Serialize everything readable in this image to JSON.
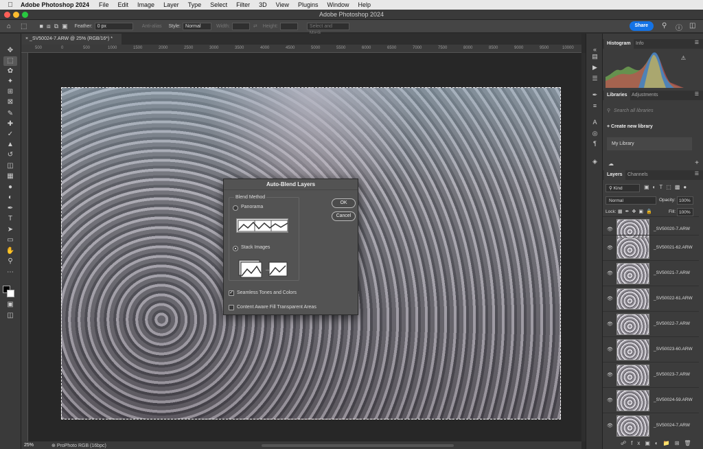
{
  "menubar": {
    "app_name": "Adobe Photoshop 2024",
    "items": [
      "File",
      "Edit",
      "Image",
      "Layer",
      "Type",
      "Select",
      "Filter",
      "3D",
      "View",
      "Plugins",
      "Window",
      "Help"
    ]
  },
  "window": {
    "title": "Adobe Photoshop 2024"
  },
  "options": {
    "feather_label": "Feather:",
    "feather_value": "0 px",
    "antialias_label": "Anti-alias",
    "style_label": "Style:",
    "style_value": "Normal",
    "width_label": "Width:",
    "height_label": "Height:",
    "select_mask_label": "Select and Mask...",
    "share_label": "Share"
  },
  "document": {
    "tab_label": "_SV50024-7.ARW @ 25% (RGB/16*) *",
    "zoom": "25%",
    "color_profile": "ProPhoto RGB (16bpc)"
  },
  "ruler_labels": [
    "500",
    "0",
    "500",
    "1000",
    "1500",
    "2000",
    "2500",
    "3000",
    "3500",
    "4000",
    "4500",
    "5000",
    "5500",
    "6000",
    "6500",
    "7000",
    "7500",
    "8000",
    "8500",
    "9000",
    "9500",
    "10000"
  ],
  "dialog": {
    "title": "Auto-Blend Layers",
    "group_label": "Blend Method",
    "option_panorama": "Panorama",
    "option_stack": "Stack Images",
    "seamless_label": "Seamless Tones and Colors",
    "content_aware_label": "Content Aware Fill Transparent Areas",
    "ok_label": "OK",
    "cancel_label": "Cancel",
    "selected_method": "Stack Images",
    "seamless_checked": true,
    "content_aware_checked": false
  },
  "panels": {
    "histogram_tab": "Histogram",
    "info_tab": "Info",
    "libraries_tab": "Libraries",
    "adjustments_tab": "Adjustments",
    "search_placeholder": "Search all libraries",
    "create_library": "Create new library",
    "my_library": "My Library",
    "layers_tab": "Layers",
    "channels_tab": "Channels",
    "kind_label": "Kind",
    "blend_mode": "Normal",
    "opacity_label": "Opacity:",
    "opacity_value": "100%",
    "lock_label": "Lock:",
    "fill_label": "Fill:",
    "fill_value": "100%"
  },
  "layers": [
    "_SV50020-7.ARW",
    "_SV50021-62.ARW",
    "_SV50021-7.ARW",
    "_SV50022-61.ARW",
    "_SV50022-7.ARW",
    "_SV50023-60.ARW",
    "_SV50023-7.ARW",
    "_SV50024-59.ARW",
    "_SV50024-7.ARW"
  ],
  "colors": {
    "accent": "#1473e6",
    "panel_bg": "#3c3c3c",
    "dialog_bg": "#535353"
  }
}
